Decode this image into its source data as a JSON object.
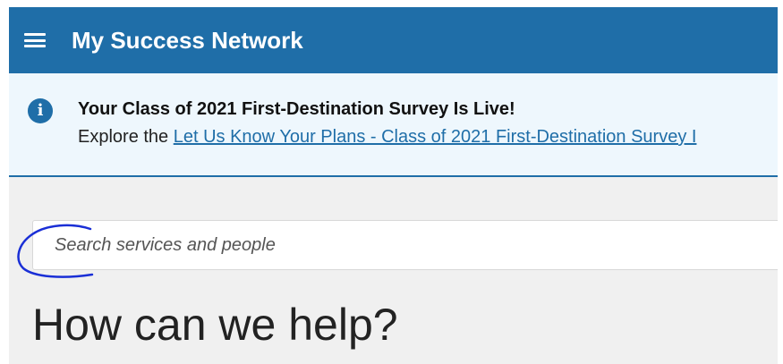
{
  "header": {
    "app_title": "My Success Network",
    "menu_icon": "hamburger-menu-icon"
  },
  "banner": {
    "icon": "info-icon",
    "icon_glyph": "i",
    "title": "Your Class of 2021 First-Destination Survey Is Live!",
    "body_prefix": "Explore the ",
    "link_text": "Let Us Know Your Plans - Class of 2021 First-Destination Survey I"
  },
  "search": {
    "placeholder": "Search services and people",
    "value": ""
  },
  "main": {
    "headline": "How can we help?"
  },
  "colors": {
    "topbar": "#1f6ea8",
    "banner_bg": "#eef7fd",
    "page_bg": "#f0f0f0",
    "annotation_stroke": "#1a2fd6"
  }
}
